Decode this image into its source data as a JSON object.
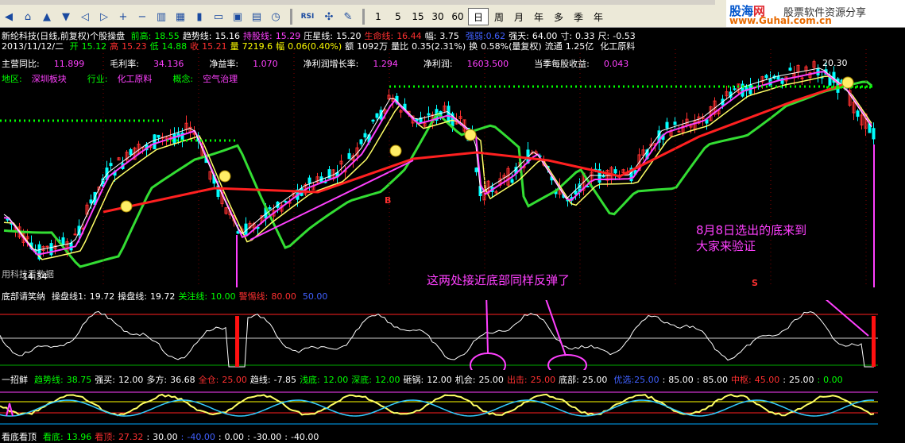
{
  "toolbar": {
    "nav_icons": [
      "back-icon",
      "home-icon",
      "up-icon",
      "down-icon",
      "left-icon",
      "right-icon",
      "zoom-in-icon",
      "zoom-out-icon",
      "kline-icon",
      "grid-icon",
      "candle-icon",
      "screen-icon",
      "fs-icon",
      "f10-icon",
      "clock-icon"
    ],
    "tool_icons": [
      "rsi-icon",
      "cross-icon",
      "draw-icon"
    ],
    "rsi_label": "RSI",
    "periods": [
      "1",
      "5",
      "15",
      "30",
      "60",
      "日",
      "周",
      "月",
      "年",
      "多",
      "季",
      "年"
    ],
    "active_period": "日"
  },
  "logo": {
    "brand_a": "股海",
    "brand_b": "网",
    "slogan": "股票软件资源分享",
    "url": "www.Guhai.com.cn"
  },
  "stock_header": {
    "name": "新纶科技(日线,前复权)个股操盘",
    "items": [
      {
        "label": "前高:",
        "value": "18.55",
        "color": "g"
      },
      {
        "label": "趋势线:",
        "value": "15.16",
        "color": "w"
      },
      {
        "label": "持股线:",
        "value": "15.29",
        "color": "m"
      },
      {
        "label": "压星线:",
        "value": "15.20",
        "color": "w"
      },
      {
        "label": "生命线:",
        "value": "16.44",
        "color": "r"
      },
      {
        "label": "幅:",
        "value": "3.75",
        "color": "w"
      },
      {
        "label": "",
        "value": "强弱:0.62",
        "color": "b"
      },
      {
        "label": "强天:",
        "value": "64.00",
        "color": "w"
      },
      {
        "label": "寸:",
        "value": "0.33",
        "color": "w"
      },
      {
        "label": "尺:",
        "value": "-0.53",
        "color": "w"
      }
    ]
  },
  "quote_line": {
    "date": "2013/11/12/二",
    "items": [
      {
        "label": "开",
        "value": "15.12",
        "color": "g"
      },
      {
        "label": "高",
        "value": "15.23",
        "color": "r"
      },
      {
        "label": "低",
        "value": "14.88",
        "color": "g"
      },
      {
        "label": "收",
        "value": "15.21",
        "color": "r"
      },
      {
        "label": "量",
        "value": "7219.6",
        "color": "y"
      },
      {
        "label": "幅",
        "value": "0.06(0.40%)",
        "color": "y"
      },
      {
        "label": "额",
        "value": "1092万",
        "color": "w"
      },
      {
        "label": "量比",
        "value": "0.35(2.31%)",
        "color": "w"
      },
      {
        "label": "换",
        "value": "0.58%(量复权)",
        "color": "w"
      },
      {
        "label": "流通",
        "value": "1.25亿",
        "color": "w"
      },
      {
        "label": "",
        "value": "化工原料",
        "color": "w"
      }
    ]
  },
  "fundamentals": [
    {
      "label": "主营同比:",
      "value": "11.899"
    },
    {
      "label": "毛利率:",
      "value": "34.136"
    },
    {
      "label": "净益率:",
      "value": "1.070"
    },
    {
      "label": "净利润增长率:",
      "value": "1.294"
    },
    {
      "label": "净利润:",
      "value": "1603.500"
    },
    {
      "label": "当季每股收益:",
      "value": "0.043"
    }
  ],
  "sector": [
    {
      "label": "地区:",
      "value": "深圳板块"
    },
    {
      "label": "行业:",
      "value": "化工原料"
    },
    {
      "label": "概念:",
      "value": "空气治理"
    }
  ],
  "price_high_label": "20.30",
  "price_low_label": "14.34",
  "marker_b": "B",
  "marker_s": "S",
  "watermark": "用科技看数据",
  "ind1": {
    "items": [
      {
        "label": "底部请笑纳",
        "value": "",
        "color": "w"
      },
      {
        "label": "操盘线1:",
        "value": "19.72",
        "color": "w"
      },
      {
        "label": "操盘线:",
        "value": "19.72",
        "color": "w"
      },
      {
        "label": "关注线:",
        "value": "10.00",
        "color": "g"
      },
      {
        "label": "警惕线:",
        "value": "80.00",
        "color": "r"
      },
      {
        "label": "",
        "value": "50.00",
        "color": "b"
      }
    ]
  },
  "ind2": {
    "items": [
      {
        "label": "一招鲜",
        "value": "",
        "color": "w"
      },
      {
        "label": "趋势线:",
        "value": "38.75",
        "color": "g"
      },
      {
        "label": "强买:",
        "value": "12.00",
        "color": "w"
      },
      {
        "label": "多方:",
        "value": "36.68",
        "color": "w"
      },
      {
        "label": "全仓:",
        "value": "25.00",
        "color": "r"
      },
      {
        "label": "趋线:",
        "value": "-7.85",
        "color": "w"
      },
      {
        "label": "浅底:",
        "value": "12.00",
        "color": "g"
      },
      {
        "label": "深底:",
        "value": "12.00",
        "color": "g"
      },
      {
        "label": "砸锅:",
        "value": "12.00",
        "color": "w"
      },
      {
        "label": "机会:",
        "value": "25.00",
        "color": "w"
      },
      {
        "label": "出击:",
        "value": "25.00",
        "color": "r"
      },
      {
        "label": "底部:",
        "value": "25.00",
        "color": "w"
      },
      {
        "label": "",
        "value": "优选:25.00",
        "color": "b"
      },
      {
        "label": ":",
        "value": "85.00",
        "color": "w"
      },
      {
        "label": ":",
        "value": "85.00",
        "color": "w"
      },
      {
        "label": "中枢:",
        "value": "45.00",
        "color": "r"
      },
      {
        "label": ":",
        "value": "25.00",
        "color": "w"
      },
      {
        "label": ":",
        "value": "0.00",
        "color": "g"
      }
    ]
  },
  "ind3": {
    "items": [
      {
        "label": "看底看顶",
        "value": "",
        "color": "w"
      },
      {
        "label": "看底:",
        "value": "13.96",
        "color": "g"
      },
      {
        "label": "看顶:",
        "value": "27.32",
        "color": "r"
      },
      {
        "label": ":",
        "value": "30.00",
        "color": "w"
      },
      {
        "label": ":",
        "value": "-40.00",
        "color": "b"
      },
      {
        "label": ":",
        "value": "0.00",
        "color": "w"
      },
      {
        "label": ":",
        "value": "-30.00",
        "color": "w"
      },
      {
        "label": ":",
        "value": "-40.00",
        "color": "w"
      }
    ]
  },
  "annotations": {
    "bottom_note": "这两处接近底部同样反弹了",
    "pick_note_1": "8月8日选出的底来到",
    "pick_note_2": "大家来验证"
  }
}
